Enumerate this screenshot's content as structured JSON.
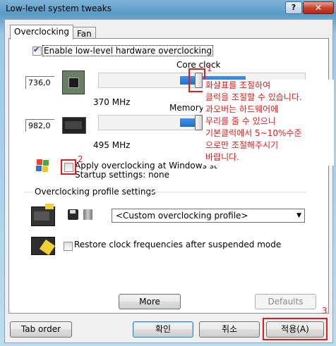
{
  "window": {
    "title": "Low-level system tweaks",
    "help": "?",
    "close": "✕"
  },
  "tabs": [
    {
      "label": "Overclocking"
    },
    {
      "label": "Fan"
    }
  ],
  "enable": {
    "label": "Enable low-level hardware overclocking",
    "checked": true
  },
  "core_clock": {
    "label": "Core clock",
    "value": "736,0",
    "mhz": "370 MHz",
    "slider_fraction": 0.49
  },
  "memory_clock": {
    "label": "Memory",
    "value": "982,0",
    "mhz": "495 MHz",
    "slider_fraction": 0.49
  },
  "apply_startup": {
    "label": "Apply overclocking at Windows st",
    "settings": "Startup settings: none",
    "checked": false
  },
  "profile": {
    "header": "Overclocking profile settings",
    "selected": "<Custom overclocking profile>"
  },
  "restore": {
    "label": "Restore clock frequencies after suspended mode",
    "checked": false
  },
  "buttons": {
    "more": "More",
    "defaults": "Defaults",
    "tab_order": "Tab order",
    "ok": "확인",
    "cancel": "취소",
    "apply": "적용(A)"
  },
  "annotation": {
    "lines": [
      "화살표를 조절하여",
      "클럭을 조절할 수 있습니다.",
      "과오버는 하드웨어에",
      "무리를 줄 수 있으니",
      "기본클럭에서 5~10%수준",
      "으로만 조절해주시기",
      "바랍니다."
    ],
    "marker1": "1",
    "marker2": "2",
    "marker3": "3"
  },
  "colors": {
    "accent": "#1f6fd0",
    "annotation": "#e41b1b"
  }
}
